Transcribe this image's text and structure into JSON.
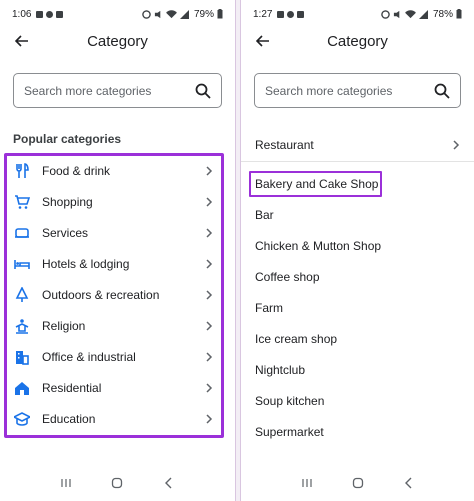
{
  "left": {
    "status": {
      "time": "1:06",
      "battery": "79%"
    },
    "title": "Category",
    "search": {
      "placeholder": "Search more categories"
    },
    "section_title": "Popular categories",
    "categories": [
      {
        "label": "Food & drink",
        "icon": "restaurant-icon"
      },
      {
        "label": "Shopping",
        "icon": "cart-icon"
      },
      {
        "label": "Services",
        "icon": "services-icon"
      },
      {
        "label": "Hotels & lodging",
        "icon": "hotel-icon"
      },
      {
        "label": "Outdoors & recreation",
        "icon": "outdoors-icon"
      },
      {
        "label": "Religion",
        "icon": "religion-icon"
      },
      {
        "label": "Office & industrial",
        "icon": "office-icon"
      },
      {
        "label": "Residential",
        "icon": "home-icon"
      },
      {
        "label": "Education",
        "icon": "school-icon"
      }
    ]
  },
  "right": {
    "status": {
      "time": "1:27",
      "battery": "78%"
    },
    "title": "Category",
    "search": {
      "placeholder": "Search more categories"
    },
    "items": [
      "Restaurant",
      "Bakery and Cake Shop",
      "Bar",
      "Chicken & Mutton Shop",
      "Coffee shop",
      "Farm",
      "Ice cream shop",
      "Nightclub",
      "Soup kitchen",
      "Supermarket"
    ]
  },
  "colors": {
    "highlight": "#9b30d9",
    "icon_blue": "#1a73e8",
    "text": "#202124"
  }
}
